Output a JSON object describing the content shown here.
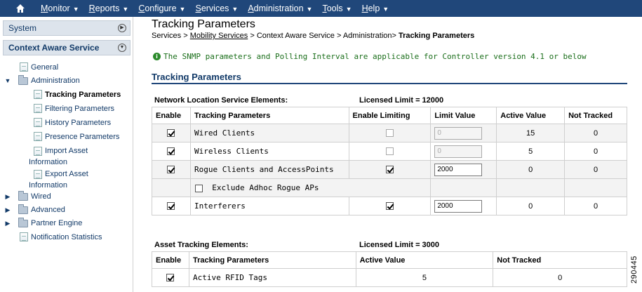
{
  "menu": {
    "items": [
      {
        "first": "M",
        "rest": "onitor"
      },
      {
        "first": "R",
        "rest": "eports"
      },
      {
        "first": "C",
        "rest": "onfigure"
      },
      {
        "first": "S",
        "rest": "ervices"
      },
      {
        "first": "A",
        "rest": "dministration"
      },
      {
        "first": "T",
        "rest": "ools"
      },
      {
        "first": "H",
        "rest": "elp"
      }
    ]
  },
  "sidebar": {
    "system": "System",
    "context": "Context Aware Service",
    "general": "General",
    "administration": "Administration",
    "tracking": "Tracking Parameters",
    "filtering": "Filtering Parameters",
    "history": "History Parameters",
    "presence": "Presence Parameters",
    "import_1": "Import Asset",
    "import_2": "Information",
    "export_1": "Export Asset",
    "export_2": "Information",
    "wired": "Wired",
    "advanced": "Advanced",
    "partner": "Partner Engine",
    "notification": "Notification Statistics"
  },
  "page": {
    "title": "Tracking Parameters",
    "crumb_services": "Services",
    "crumb_mobility": "Mobility Services",
    "crumb_cas": "Context Aware Service",
    "crumb_admin": "Administration",
    "crumb_current": "Tracking Parameters",
    "notice": "The SNMP parameters and Polling Interval are applicable for Controller version 4.1 or below",
    "section": "Tracking Parameters"
  },
  "nls": {
    "label": "Network Location Service Elements:",
    "limit": "Licensed Limit = 12000",
    "headers": [
      "Enable",
      "Tracking Parameters",
      "Enable Limiting",
      "Limit Value",
      "Active Value",
      "Not Tracked"
    ],
    "rows": [
      {
        "name": "Wired Clients",
        "limit": "0",
        "active": "15",
        "not_tracked": "0"
      },
      {
        "name": "Wireless Clients",
        "limit": "0",
        "active": "5",
        "not_tracked": "0"
      },
      {
        "name": "Rogue Clients and AccessPoints",
        "limit": "2000",
        "active": "0",
        "not_tracked": "0"
      },
      {
        "name": "Exclude Adhoc Rogue APs"
      },
      {
        "name": "Interferers",
        "limit": "2000",
        "active": "0",
        "not_tracked": "0"
      }
    ]
  },
  "asset": {
    "label": "Asset Tracking Elements:",
    "limit": "Licensed Limit = 3000",
    "headers": [
      "Enable",
      "Tracking Parameters",
      "Active Value",
      "Not Tracked"
    ],
    "rows": [
      {
        "name": "Active RFID Tags",
        "active": "5",
        "not_tracked": "0"
      }
    ]
  },
  "figure_number": "290445"
}
